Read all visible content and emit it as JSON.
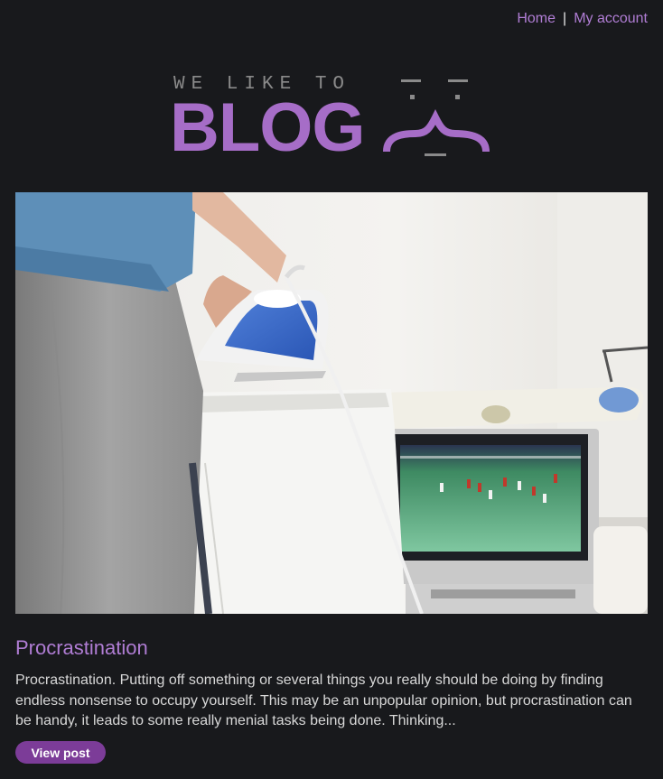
{
  "nav": {
    "home_label": "Home",
    "separator": "|",
    "account_label": "My account"
  },
  "logo": {
    "tagline": "WE LIKE TO",
    "wordmark": "BLOG",
    "icon": "face-icon",
    "color": "#a66dc7"
  },
  "post": {
    "image_icon": "ironing-photo",
    "title": "Procrastination",
    "excerpt": "Procrastination. Putting off something or several things you really should be doing by finding endless nonsense to occupy yourself. This may be an unpopular opinion, but procrastination can be handy, it leads to some really menial tasks being done. Thinking...",
    "button_label": "View post"
  },
  "colors": {
    "background": "#18191c",
    "accent": "#b07dd4",
    "button": "#7c3c98"
  }
}
